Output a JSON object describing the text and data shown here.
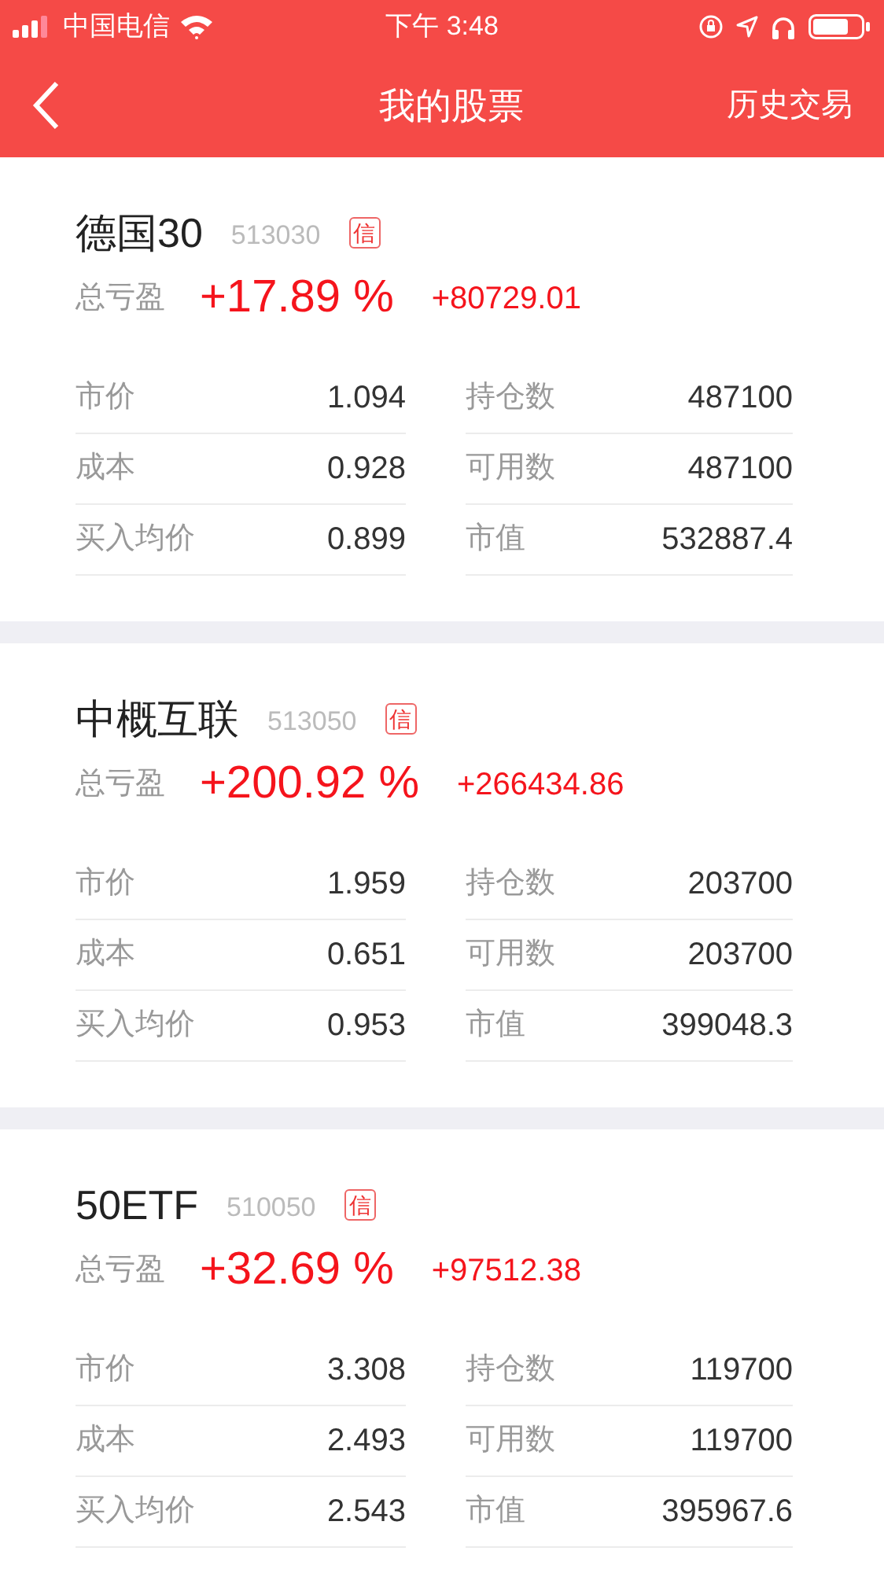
{
  "status_bar": {
    "carrier": "中国电信",
    "time": "下午 3:48"
  },
  "nav": {
    "title": "我的股票",
    "action": "历史交易"
  },
  "stocks": [
    {
      "name": "德国30",
      "code": "513030",
      "badge": "信",
      "profit_label": "总亏盈",
      "profit_pct": "+17.89 %",
      "profit_amount": "+80729.01",
      "left": [
        {
          "label": "市价",
          "value": "1.094"
        },
        {
          "label": "成本",
          "value": "0.928"
        },
        {
          "label": "买入均价",
          "value": "0.899"
        }
      ],
      "right": [
        {
          "label": "持仓数",
          "value": "487100"
        },
        {
          "label": "可用数",
          "value": "487100"
        },
        {
          "label": "市值",
          "value": "532887.4"
        }
      ]
    },
    {
      "name": "中概互联",
      "code": "513050",
      "badge": "信",
      "profit_label": "总亏盈",
      "profit_pct": "+200.92 %",
      "profit_amount": "+266434.86",
      "left": [
        {
          "label": "市价",
          "value": "1.959"
        },
        {
          "label": "成本",
          "value": "0.651"
        },
        {
          "label": "买入均价",
          "value": "0.953"
        }
      ],
      "right": [
        {
          "label": "持仓数",
          "value": "203700"
        },
        {
          "label": "可用数",
          "value": "203700"
        },
        {
          "label": "市值",
          "value": "399048.3"
        }
      ]
    },
    {
      "name": "50ETF",
      "code": "510050",
      "badge": "信",
      "profit_label": "总亏盈",
      "profit_pct": "+32.69 %",
      "profit_amount": "+97512.38",
      "left": [
        {
          "label": "市价",
          "value": "3.308"
        },
        {
          "label": "成本",
          "value": "2.493"
        },
        {
          "label": "买入均价",
          "value": "2.543"
        }
      ],
      "right": [
        {
          "label": "持仓数",
          "value": "119700"
        },
        {
          "label": "可用数",
          "value": "119700"
        },
        {
          "label": "市值",
          "value": "395967.6"
        }
      ]
    }
  ]
}
